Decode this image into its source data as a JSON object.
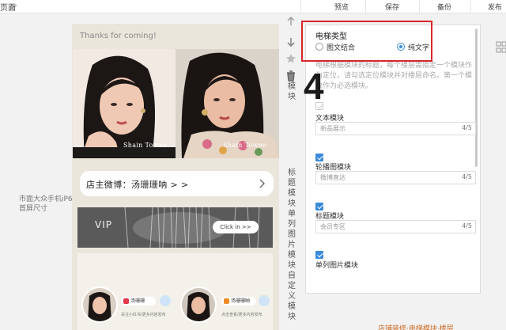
{
  "toolbar": {
    "partial_label": "页面",
    "preview_label": "预览",
    "save_label": "保存",
    "backup_label": "备份",
    "publish_label": "发布"
  },
  "left_label": "市面大众手机iP6首屏尺寸",
  "phone": {
    "thanks_text": "Thanks for coming!",
    "watermark_left": "Shain Towne",
    "watermark_right": "Shain Towne",
    "weibo_text": "店主微博：汤珊珊呐 > >",
    "vip_text": "VIP",
    "clickin_text": "Click in >>",
    "card_left_name": "汤珊珊",
    "card_right_name": "汤珊珊呐",
    "card_left_caption": "关注小红书/更多内容发布",
    "card_right_caption": "点击查看/更多内容发布"
  },
  "vertical_tabs": {
    "tab_mid": "模块",
    "tab_lower": "标题模块单列图片模块自定义模块"
  },
  "annotation_number": "4",
  "panel": {
    "elevator_title": "电梯类型",
    "option_mixed": "图文结合",
    "option_text": "纯文字",
    "selected_option": "纯文字",
    "description": "电梯根据模块的标题，每个楼层需指定一个模块作为定位，请勾选定位模块并对楼层命名。第一个模块作为必选模块。",
    "modules": [
      {
        "label": "文本模块",
        "value": "新品展示",
        "count": "4/5",
        "checked": false
      },
      {
        "label": "轮播图模块",
        "value": "微博直达",
        "count": "4/5",
        "checked": true
      },
      {
        "label": "标题模块",
        "value": "会员专区",
        "count": "4/5",
        "checked": true
      },
      {
        "label": "单列图片模块",
        "value": "",
        "count": "",
        "checked": true
      }
    ]
  },
  "bottom_partial_text": "店铺装修·电梯模块·楼层",
  "colors": {
    "accent_blue": "#3b8ad9",
    "highlight_red": "#d8262a",
    "phone_bg": "#eae6dc"
  }
}
